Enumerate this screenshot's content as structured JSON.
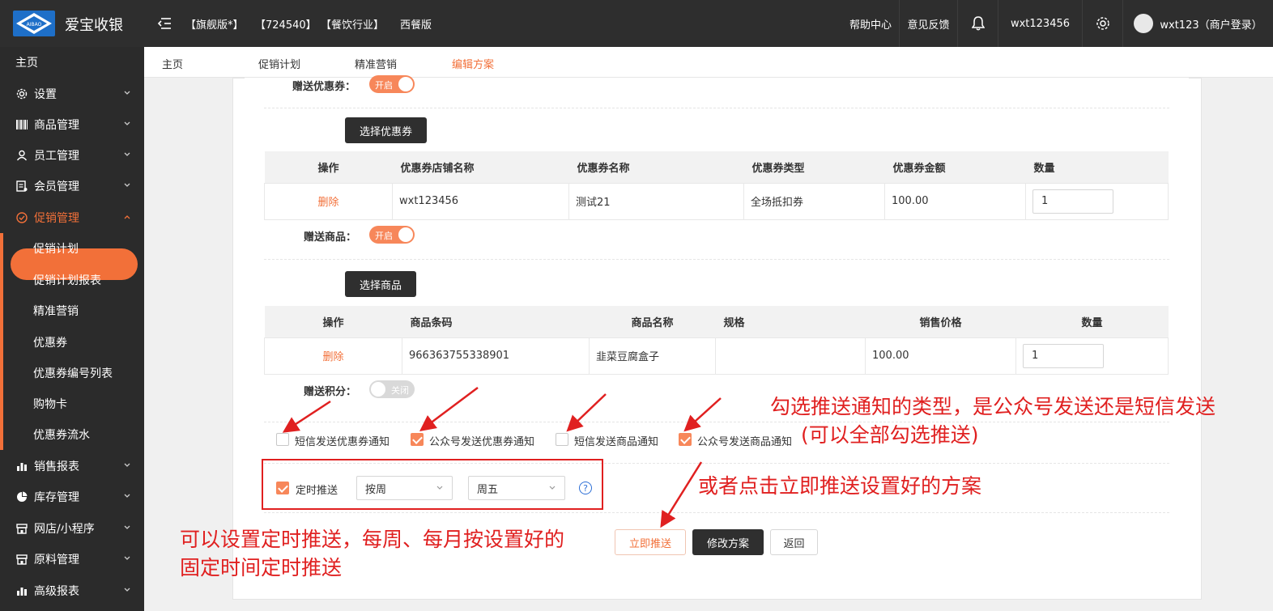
{
  "topbar": {
    "brand": "爱宝收银",
    "logo_text": "AIBAO",
    "edition": "【旗舰版*】",
    "account_id": "【724540】",
    "industry": "【餐饮行业】",
    "version": "西餐版",
    "help": "帮助中心",
    "feedback": "意见反馈",
    "store": "wxt123456",
    "user": "wxt123（商户登录）"
  },
  "sidebar": {
    "home": "主页",
    "items": [
      {
        "label": "设置",
        "icon": "gear-icon"
      },
      {
        "label": "商品管理",
        "icon": "barcode-icon"
      },
      {
        "label": "员工管理",
        "icon": "user-icon"
      },
      {
        "label": "会员管理",
        "icon": "member-card-icon"
      },
      {
        "label": "促销管理",
        "icon": "check-circle-icon"
      }
    ],
    "sub_items": [
      "促销计划",
      "促销计划报表",
      "精准营销",
      "优惠券",
      "优惠券编号列表",
      "购物卡",
      "优惠券流水"
    ],
    "bottom_items": [
      {
        "label": "销售报表",
        "icon": "bar-chart-icon"
      },
      {
        "label": "库存管理",
        "icon": "pie-chart-icon"
      },
      {
        "label": "网店/小程序",
        "icon": "store-icon"
      },
      {
        "label": "原料管理",
        "icon": "store-icon"
      },
      {
        "label": "高级报表",
        "icon": "bar-chart-icon"
      }
    ]
  },
  "tabs": [
    "主页",
    "促销计划",
    "精准营销",
    "编辑方案"
  ],
  "form": {
    "gift_coupon_label": "赠送优惠券：",
    "gift_coupon_switch": "开启",
    "select_coupon_btn": "选择优惠券",
    "coupon_table": {
      "headers": [
        "操作",
        "优惠券店铺名称",
        "优惠券名称",
        "优惠券类型",
        "优惠券金额",
        "数量"
      ],
      "rows": [
        {
          "action": "删除",
          "store": "wxt123456",
          "name": "测试21",
          "type": "全场抵扣券",
          "amount": "100.00",
          "qty": "1"
        }
      ]
    },
    "gift_goods_label": "赠送商品：",
    "gift_goods_switch": "开启",
    "select_goods_btn": "选择商品",
    "goods_table": {
      "headers": [
        "操作",
        "商品条码",
        "商品名称",
        "规格",
        "销售价格",
        "数量"
      ],
      "rows": [
        {
          "action": "删除",
          "barcode": "966363755338901",
          "name": "韭菜豆腐盒子",
          "spec": "",
          "price": "100.00",
          "qty": "1"
        }
      ]
    },
    "gift_points_label": "赠送积分：",
    "gift_points_switch": "关闭",
    "notify_options": [
      {
        "label": "短信发送优惠券通知",
        "checked": false
      },
      {
        "label": "公众号发送优惠券通知",
        "checked": true
      },
      {
        "label": "短信发送商品通知",
        "checked": false
      },
      {
        "label": "公众号发送商品通知",
        "checked": true
      }
    ],
    "schedule_label": "定时推送",
    "schedule_checked": true,
    "schedule_period": "按周",
    "schedule_day": "周五",
    "help_glyph": "?",
    "push_now_btn": "立即推送",
    "modify_btn": "修改方案",
    "back_btn": "返回"
  },
  "annotations": {
    "notify_line1": "勾选推送通知的类型，是公众号发送还是短信发送",
    "notify_line2": "(可以全部勾选推送)",
    "push_now": "或者点击立即推送设置好的方案",
    "schedule_line1": "可以设置定时推送，每周、每月按设置好的",
    "schedule_line2": "固定时间定时推送"
  },
  "colors": {
    "accent": "#f27039",
    "topbar": "#2e2e2e",
    "sidebar": "#2b2b2b",
    "annotation": "#e02020"
  }
}
